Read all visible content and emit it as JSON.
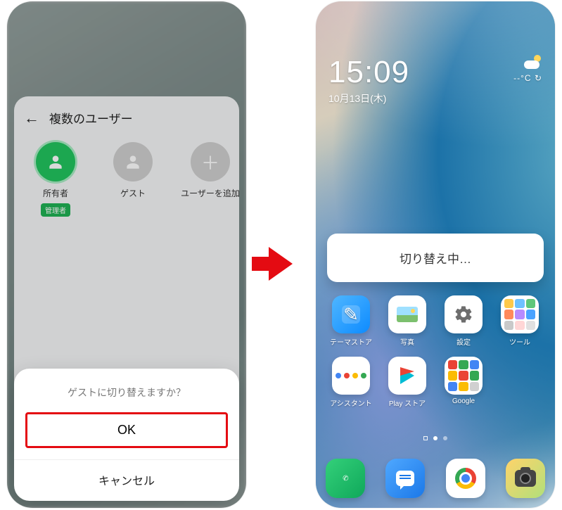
{
  "left": {
    "header": {
      "title": "複数のユーザー"
    },
    "users": {
      "owner": {
        "label": "所有者",
        "badge": "管理者"
      },
      "guest": {
        "label": "ゲスト"
      },
      "add": {
        "label": "ユーザーを追加"
      }
    },
    "dialog": {
      "message": "ゲストに切り替えますか？",
      "ok": "OK",
      "cancel": "キャンセル"
    }
  },
  "right": {
    "clock": "15:09",
    "date": "10月13日(木)",
    "temp": "--°C",
    "refresh_glyph": "↻",
    "toast": "切り替え中…",
    "apps": {
      "theme": "テーマストア",
      "photos": "写真",
      "settings": "設定",
      "tools": "ツール",
      "assistant": "アシスタント",
      "play": "Play ストア",
      "google": "Google"
    }
  }
}
